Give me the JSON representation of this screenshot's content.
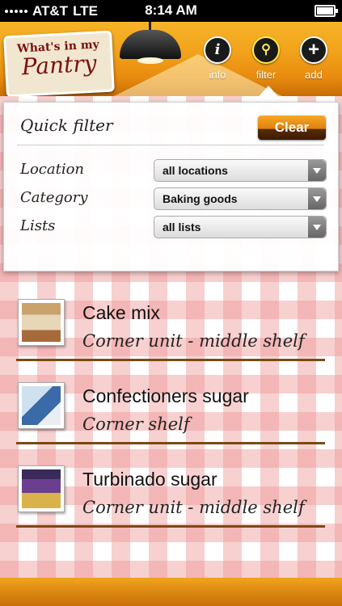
{
  "status": {
    "carrier": "AT&T",
    "network": "LTE",
    "time": "8:14 AM"
  },
  "header": {
    "logo_line1": "What's in my",
    "logo_line2": "Pantry",
    "buttons": [
      {
        "icon": "info-icon",
        "glyph": "i",
        "label": "info"
      },
      {
        "icon": "search-icon",
        "glyph": "⚲",
        "label": "filter"
      },
      {
        "icon": "add-icon",
        "glyph": "+",
        "label": "add"
      }
    ]
  },
  "filter": {
    "title": "Quick filter",
    "clear_label": "Clear",
    "rows": [
      {
        "label": "Location",
        "value": "all locations"
      },
      {
        "label": "Category",
        "value": "Baking goods"
      },
      {
        "label": "Lists",
        "value": "all lists"
      }
    ]
  },
  "items": [
    {
      "name": "Cake mix",
      "location": "Corner unit - middle shelf"
    },
    {
      "name": "Confectioners sugar",
      "location": "Corner shelf"
    },
    {
      "name": "Turbinado sugar",
      "location": "Corner unit - middle shelf"
    }
  ]
}
